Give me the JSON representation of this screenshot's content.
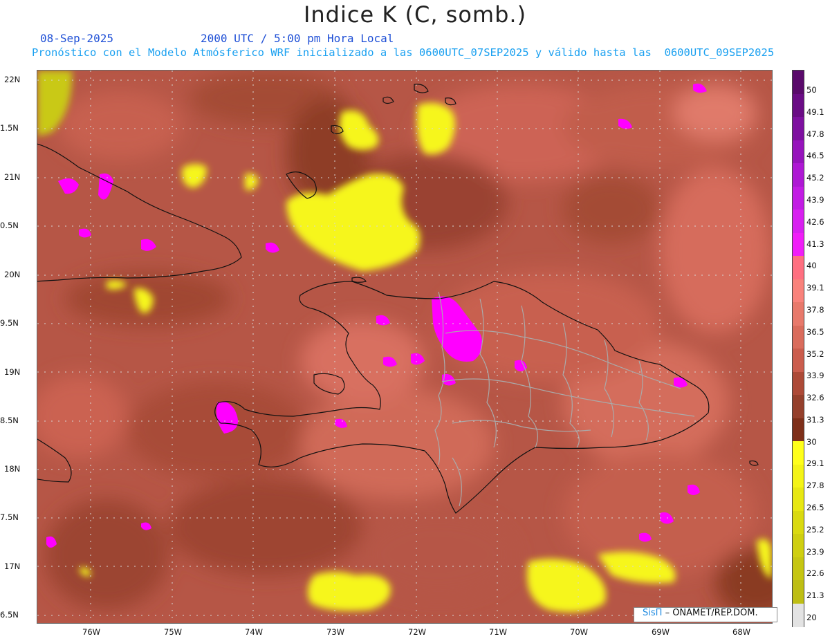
{
  "title": "Indice K (C, somb.)",
  "header": {
    "date": "08-Sep-2025",
    "time": "2000 UTC / 5:00 pm Hora Local",
    "model": "Pronóstico con el Modelo Atmósferico WRF inicializado a las 0600UTC_07SEP2025 y válido hasta las  0600UTC_09SEP2025"
  },
  "axes": {
    "lat_labels": [
      "22N",
      "1.5N",
      "21N",
      "0.5N",
      "20N",
      "9.5N",
      "19N",
      "8.5N",
      "18N",
      "7.5N",
      "17N",
      "6.5N"
    ],
    "lon_labels": [
      "76W",
      "75W",
      "74W",
      "73W",
      "72W",
      "71W",
      "70W",
      "69W",
      "68W"
    ]
  },
  "colorbar": {
    "labels": [
      "50",
      "49.1",
      "47.8",
      "46.5",
      "45.2",
      "43.9",
      "42.6",
      "41.3",
      "40",
      "39.1",
      "37.8",
      "36.5",
      "35.2",
      "33.9",
      "32.6",
      "31.3",
      "30",
      "29.1",
      "27.8",
      "26.5",
      "25.2",
      "23.9",
      "22.6",
      "21.3",
      "20"
    ],
    "colors": [
      "#5a0a6b",
      "#6a0c85",
      "#7e10a0",
      "#9614bc",
      "#ae18d4",
      "#c21ce4",
      "#d820f0",
      "#f01ef8",
      "#ff6f80",
      "#f9827b",
      "#e8796b",
      "#da6c5c",
      "#cb5d4d",
      "#ad4a37",
      "#95402c",
      "#7e2f19",
      "#ffff1a",
      "#f4f416",
      "#e8e812",
      "#dada10",
      "#cfcf10",
      "#c6c612",
      "#bebe14",
      "#e3e3e3"
    ]
  },
  "map": {
    "fill_colors": {
      "base": "#b65646",
      "dark": "#8e3d28",
      "mid": "#cd6455",
      "light": "#e07464",
      "pink": "#ff00ff",
      "yellow": "#f6f61a",
      "border": "#111111",
      "province": "#aaaaaa"
    }
  },
  "credit": {
    "brand": "SisΠ",
    "text": "– ONAMET/REP.DOM."
  }
}
